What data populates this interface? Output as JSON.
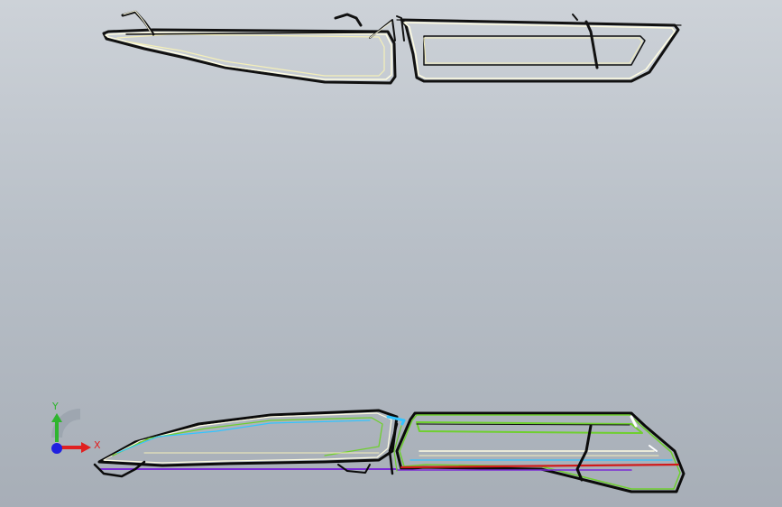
{
  "viewport": {
    "background_top": "#cdd2d8",
    "background_bottom": "#a7aeb7"
  },
  "triad": {
    "x_label": "X",
    "y_label": "Y",
    "x_color": "#e02020",
    "y_color": "#2fb52f",
    "z_color": "#2020e0"
  },
  "models": {
    "top_view_colors": [
      "#fffde2",
      "#f4efb9",
      "#111111"
    ],
    "bottom_view_colors": [
      "#0b0b0b",
      "#6fcf2f",
      "#33c4ff",
      "#7b2bd6",
      "#d11a1a",
      "#ffffff"
    ]
  }
}
